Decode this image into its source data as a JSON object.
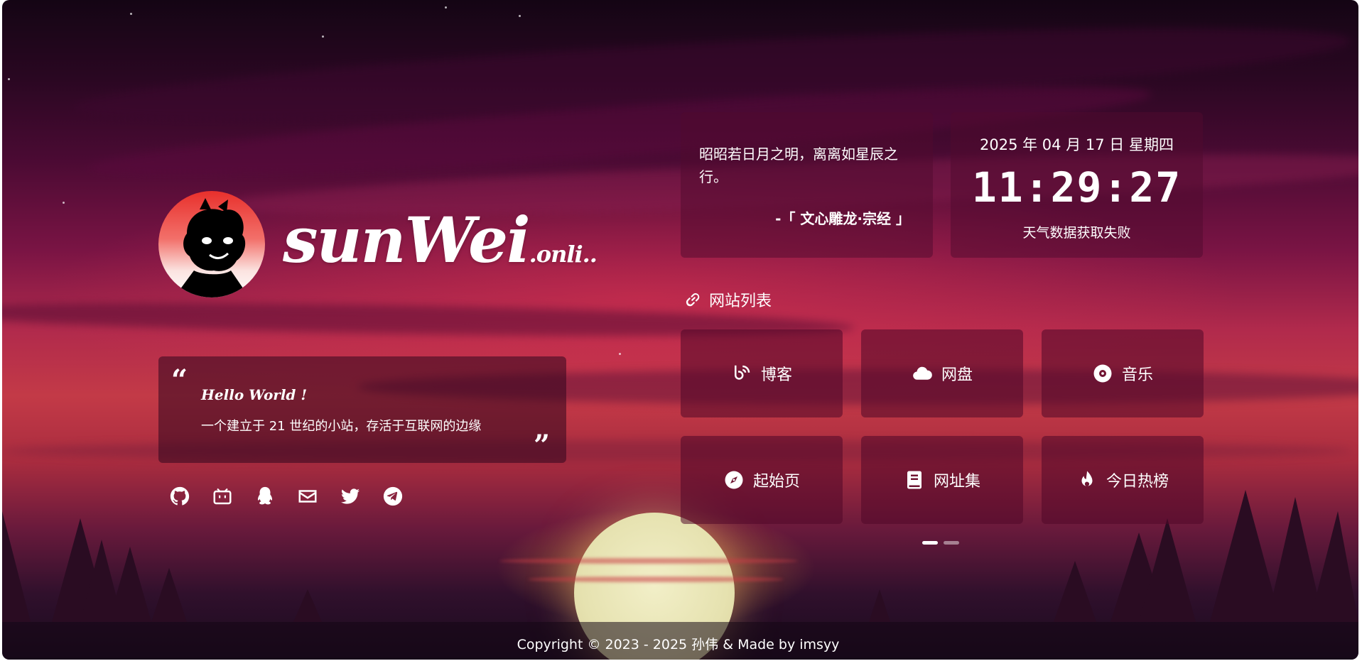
{
  "brand": {
    "name": "sunWei",
    "suffix": ".onli.."
  },
  "intro": {
    "greeting": "Hello World !",
    "description": "一个建立于 21 世纪的小站，存活于互联网的边缘"
  },
  "socials": [
    "github-icon",
    "bilibili-icon",
    "qq-icon",
    "mail-icon",
    "twitter-icon",
    "telegram-icon"
  ],
  "poem": {
    "text": "昭昭若日月之明，离离如星辰之行。",
    "source": "-「 文心雕龙·宗经 」"
  },
  "clock": {
    "date": "2025 年 04 月 17 日 星期四",
    "time": "11:29:27",
    "weather": "天气数据获取失败"
  },
  "sites": {
    "title": "网站列表",
    "items": [
      {
        "label": "博客",
        "icon": "blog-icon"
      },
      {
        "label": "网盘",
        "icon": "cloud-icon"
      },
      {
        "label": "音乐",
        "icon": "music-disc-icon"
      },
      {
        "label": "起始页",
        "icon": "compass-icon"
      },
      {
        "label": "网址集",
        "icon": "book-icon"
      },
      {
        "label": "今日热榜",
        "icon": "fire-icon"
      }
    ],
    "pages": 2,
    "active_page": 1
  },
  "footer": {
    "copyright": "Copyright © 2023 - 2025 孙伟 & Made by imsyy"
  },
  "colors": {
    "accent": "#ffffff",
    "panel": "#50082d",
    "sky_top": "#140514",
    "sky_mid": "#c33a47"
  }
}
